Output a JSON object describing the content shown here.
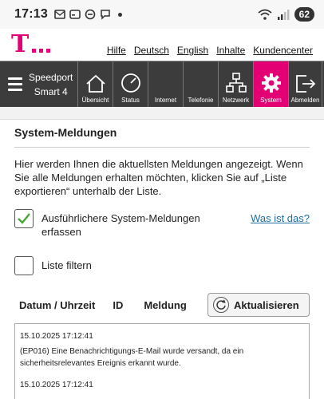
{
  "status_bar": {
    "time": "17:13",
    "battery": "62",
    "icons": [
      "mail-icon",
      "caption-icon",
      "link-icon",
      "chat-icon",
      "wifi-icon",
      "signal-icon"
    ]
  },
  "header": {
    "logo_letter": "T",
    "links": [
      "Hilfe",
      "Deutsch",
      "English",
      "Inhalte",
      "Kundencenter"
    ]
  },
  "nav": {
    "brand_line1": "Speedport",
    "brand_line2": "Smart 4",
    "items": [
      {
        "label": "Übersicht",
        "icon": "home-icon"
      },
      {
        "label": "Status",
        "icon": "gauge-icon"
      },
      {
        "label": "Internet",
        "icon": "globe-icon"
      },
      {
        "label": "Telefonie",
        "icon": "phone-icon"
      },
      {
        "label": "Netzwerk",
        "icon": "network-icon"
      },
      {
        "label": "System",
        "icon": "gear-icon",
        "active": true
      },
      {
        "label": "Abmelden",
        "icon": "logout-icon"
      }
    ],
    "accent_color": "#e20074"
  },
  "main": {
    "title": "System-Meldungen",
    "intro": "Hier werden Ihnen die aktuellsten Meldungen angezeigt. Wenn Sie alle Meldungen erhalten möchten, klicken Sie auf „Liste exportieren“ unterhalb der Liste.",
    "verbose_checkbox": {
      "label": "Ausführlichere System-Meldungen erfassen",
      "checked": true
    },
    "help_link": "Was ist das?",
    "filter_checkbox": {
      "label": "Liste filtern",
      "checked": false
    },
    "table_headers": [
      "Datum / Uhrzeit",
      "ID",
      "Meldung"
    ],
    "refresh_button": "Aktualisieren",
    "log_entries": [
      {
        "timestamp": "15.10.2025 17:12:41",
        "message": "(EP016) Eine Benachrichtigungs-E-Mail wurde versandt, da ein sicherheitsrelevantes Ereignis erkannt wurde."
      },
      {
        "timestamp": "15.10.2025 17:12:41",
        "message": ""
      }
    ]
  }
}
